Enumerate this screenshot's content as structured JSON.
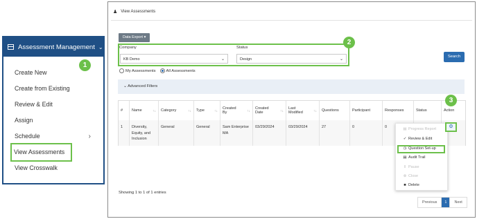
{
  "menu": {
    "header": "Assessment Management",
    "items": [
      {
        "label": "Create New"
      },
      {
        "label": "Create from Existing"
      },
      {
        "label": "Review & Edit"
      },
      {
        "label": "Assign"
      },
      {
        "label": "Schedule"
      },
      {
        "label": "View Assessments"
      },
      {
        "label": "View Crosswalk"
      }
    ]
  },
  "badges": [
    "1",
    "2",
    "3"
  ],
  "page": {
    "title": "View Assessments"
  },
  "toolbar": {
    "export_label": "Data Export ▾"
  },
  "filters": {
    "company_label": "Company",
    "company_value": "KB Demo",
    "status_label": "Status",
    "status_value": "Design",
    "search_label": "Search"
  },
  "scope": {
    "my_label": "My Assessments",
    "all_label": "All Assessments",
    "selected": "all"
  },
  "advanced": {
    "label": "Advanced Filters"
  },
  "table": {
    "headers": [
      "#",
      "Name",
      "Category",
      "Type",
      "Created By",
      "Created Date",
      "Last Modified",
      "Questions",
      "Participant",
      "Responses",
      "Status",
      "Action"
    ],
    "rows": [
      {
        "num": "1",
        "name": "Diversity, Equity, and Inclusion",
        "category": "General",
        "type": "General",
        "created_by": "Sam Enterprise MA",
        "created_date": "03/29/2024",
        "last_modified": "03/29/2024",
        "questions": "27",
        "participant": "0",
        "responses": "0",
        "status": ""
      }
    ]
  },
  "action_menu": [
    {
      "label": "Progress Report",
      "icon": "chart-icon",
      "enabled": false
    },
    {
      "label": "Review & Edit",
      "icon": "check-circle-icon",
      "enabled": true
    },
    {
      "label": "Question Set-up",
      "icon": "clock-icon",
      "enabled": true
    },
    {
      "label": "Audit Trail",
      "icon": "list-icon",
      "enabled": true
    },
    {
      "label": "Pause",
      "icon": "pause-icon",
      "enabled": false
    },
    {
      "label": "Close",
      "icon": "close-circle-icon",
      "enabled": false
    },
    {
      "label": "Delete",
      "icon": "trash-icon",
      "enabled": true
    }
  ],
  "footer": {
    "entries": "Showing 1 to 1 of 1 entries"
  },
  "pagination": {
    "previous": "Previous",
    "current": "1",
    "next": "Next"
  },
  "colors": {
    "nav": "#1f4f85",
    "highlight": "#6cc04a",
    "primary": "#2b6cb0"
  }
}
